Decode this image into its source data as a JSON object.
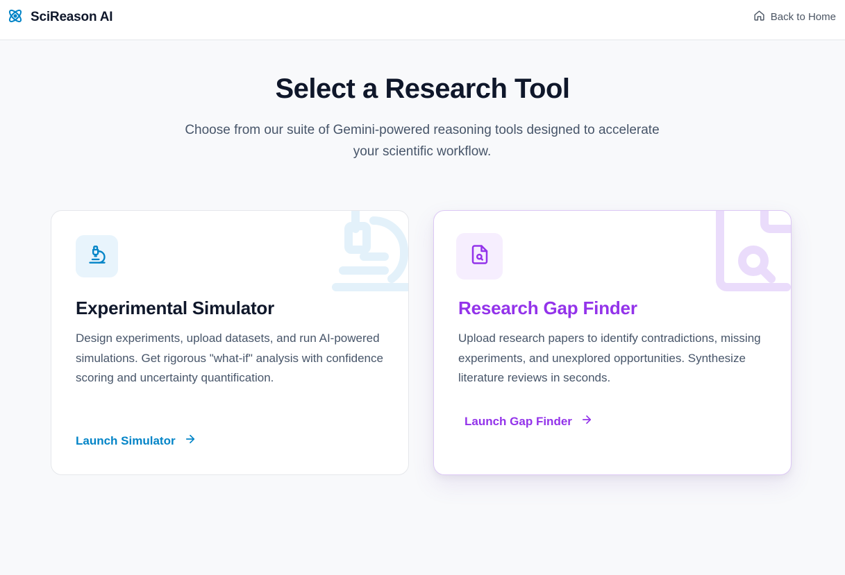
{
  "header": {
    "brand_name": "SciReason AI",
    "brand_icon": "atom-icon",
    "back_label": "Back to Home",
    "back_icon": "home-icon"
  },
  "hero": {
    "title": "Select a Research Tool",
    "subtitle": "Choose from our suite of Gemini-powered reasoning tools designed to accelerate your scientific workflow."
  },
  "cards": [
    {
      "title": "Experimental Simulator",
      "description": "Design experiments, upload datasets, and run AI-powered simulations. Get rigorous \"what-if\" analysis with confidence scoring and uncertainty quantification.",
      "launch_label": "Launch Simulator",
      "icon": "microscope-icon",
      "accent": "#0284c7"
    },
    {
      "title": "Research Gap Finder",
      "description": "Upload research papers to identify contradictions, missing experiments, and unexplored opportunities. Synthesize literature reviews in seconds.",
      "launch_label": "Launch Gap Finder",
      "icon": "file-search-icon",
      "accent": "#9333ea"
    }
  ],
  "colors": {
    "background": "#f8f9fb",
    "brand_blue": "#0284c7",
    "purple": "#9333ea"
  }
}
